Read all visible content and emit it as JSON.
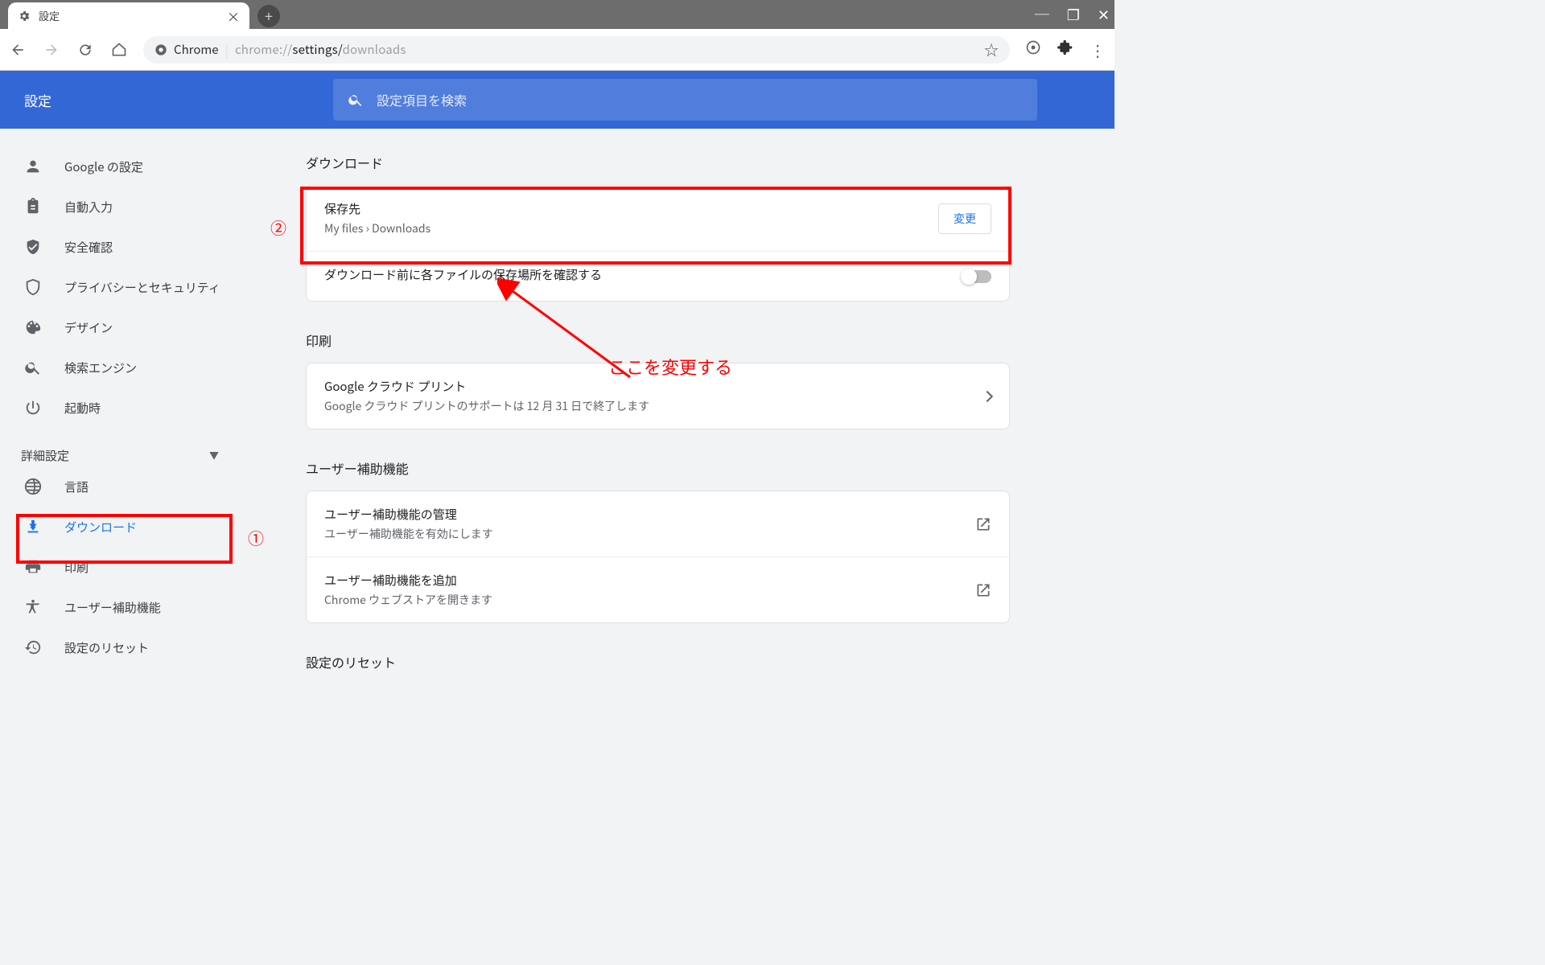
{
  "browser": {
    "tab_title": "設定",
    "omnibox_label": "Chrome",
    "omnibox_url_prefix": "chrome://",
    "omnibox_url_bold": "settings/",
    "omnibox_url_tail": "downloads"
  },
  "header": {
    "app_title": "設定",
    "search_placeholder": "設定項目を検索"
  },
  "sidebar": {
    "items": [
      {
        "label": "Google の設定"
      },
      {
        "label": "自動入力"
      },
      {
        "label": "安全確認"
      },
      {
        "label": "プライバシーとセキュリティ"
      },
      {
        "label": "デザイン"
      },
      {
        "label": "検索エンジン"
      },
      {
        "label": "起動時"
      }
    ],
    "advanced_label": "詳細設定",
    "advanced_items": [
      {
        "label": "言語"
      },
      {
        "label": "ダウンロード"
      },
      {
        "label": "印刷"
      },
      {
        "label": "ユーザー補助機能"
      },
      {
        "label": "設定のリセット"
      }
    ]
  },
  "sections": {
    "download": {
      "title": "ダウンロード",
      "location_label": "保存先",
      "location_value": "My files › Downloads",
      "change_button": "変更",
      "ask_label": "ダウンロード前に各ファイルの保存場所を確認する"
    },
    "print": {
      "title": "印刷",
      "gcp_label": "Google クラウド プリント",
      "gcp_sub": "Google クラウド プリントのサポートは 12 月 31 日で終了します"
    },
    "a11y": {
      "title": "ユーザー補助機能",
      "manage_label": "ユーザー補助機能の管理",
      "manage_sub": "ユーザー補助機能を有効にします",
      "add_label": "ユーザー補助機能を追加",
      "add_sub": "Chrome ウェブストアを開きます"
    },
    "reset": {
      "title": "設定のリセット"
    }
  },
  "annotations": {
    "num1": "①",
    "num2": "②",
    "text": "ここを変更する"
  }
}
